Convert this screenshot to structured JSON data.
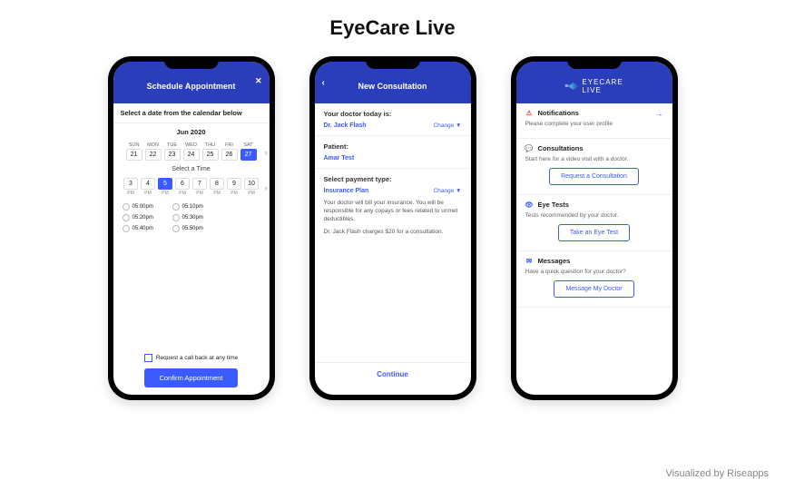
{
  "title": "EyeCare Live",
  "footer": {
    "prefix": "Visualized by ",
    "brand": "Riseapps"
  },
  "screen1": {
    "header": "Schedule Appointment",
    "instruction": "Select a date from the calendar below",
    "month": "Jun 2020",
    "days": [
      {
        "name": "SUN",
        "num": "21"
      },
      {
        "name": "MON",
        "num": "22"
      },
      {
        "name": "TUE",
        "num": "23"
      },
      {
        "name": "WED",
        "num": "24"
      },
      {
        "name": "THU",
        "num": "25"
      },
      {
        "name": "FRI",
        "num": "26"
      },
      {
        "name": "SAT",
        "num": "27"
      }
    ],
    "selectTime": "Select a Time",
    "hours": [
      {
        "h": "3",
        "ap": "PM"
      },
      {
        "h": "4",
        "ap": "PM"
      },
      {
        "h": "5",
        "ap": "PM"
      },
      {
        "h": "6",
        "ap": "PM"
      },
      {
        "h": "7",
        "ap": "PM"
      },
      {
        "h": "8",
        "ap": "PM"
      },
      {
        "h": "9",
        "ap": "PM"
      },
      {
        "h": "10",
        "ap": "PM"
      }
    ],
    "slots": [
      "05:00pm",
      "05:10pm",
      "05:20pm",
      "05:30pm",
      "05:40pm",
      "05:50pm"
    ],
    "callback": "Request a call back at any time",
    "confirm": "Confirm Appointment"
  },
  "screen2": {
    "header": "New Consultation",
    "doctorLabel": "Your doctor today is:",
    "doctor": "Dr. Jack Flash",
    "change": "Change ▼",
    "patientLabel": "Patient:",
    "patient": "Amar Test",
    "paymentLabel": "Select payment type:",
    "payment": "Insurance Plan",
    "desc1": "Your doctor will bill your insurance. You will be responsible for any copays or fees related to unmet deductibles.",
    "desc2": "Dr. Jack Flash charges $20 for a consultation.",
    "continue": "Continue"
  },
  "screen3": {
    "brand1": "EYECARE",
    "brand2": "LIVE",
    "cards": {
      "notifications": {
        "title": "Notifications",
        "sub": "Please complete your user profile"
      },
      "consultations": {
        "title": "Consultations",
        "sub": "Start here for a video visit with a doctor.",
        "btn": "Request a Consultation"
      },
      "eyetests": {
        "title": "Eye Tests",
        "sub": "Tests recommended by your doctor.",
        "btn": "Take an Eye Test"
      },
      "messages": {
        "title": "Messages",
        "sub": "Have a quick question for your doctor?",
        "btn": "Message My Doctor"
      }
    }
  }
}
